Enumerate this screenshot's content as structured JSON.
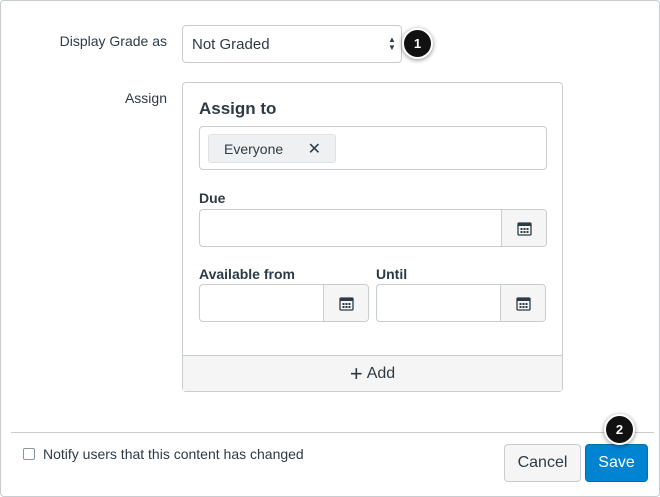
{
  "display_grade": {
    "label": "Display Grade as",
    "selected": "Not Graded",
    "callout": "1"
  },
  "assign": {
    "label": "Assign",
    "card_title": "Assign to",
    "chip_label": "Everyone",
    "chip_remove": "✕",
    "due_label": "Due",
    "due_value": "",
    "available_from_label": "Available from",
    "available_from_value": "",
    "until_label": "Until",
    "until_value": "",
    "add_plus": "+",
    "add_label": "Add"
  },
  "footer": {
    "notify_label": "Notify users that this content has changed",
    "notify_checked": false,
    "cancel_label": "Cancel",
    "save_label": "Save",
    "save_callout": "2"
  },
  "colors": {
    "primary": "#0084d1",
    "text": "#2d3b45",
    "border": "#c7cdd1",
    "callout": "#111111"
  },
  "icons": {
    "select_arrows": "up-down-arrows-icon",
    "chip_remove": "close-icon",
    "date_picker": "calendar-icon",
    "add": "plus-icon"
  }
}
